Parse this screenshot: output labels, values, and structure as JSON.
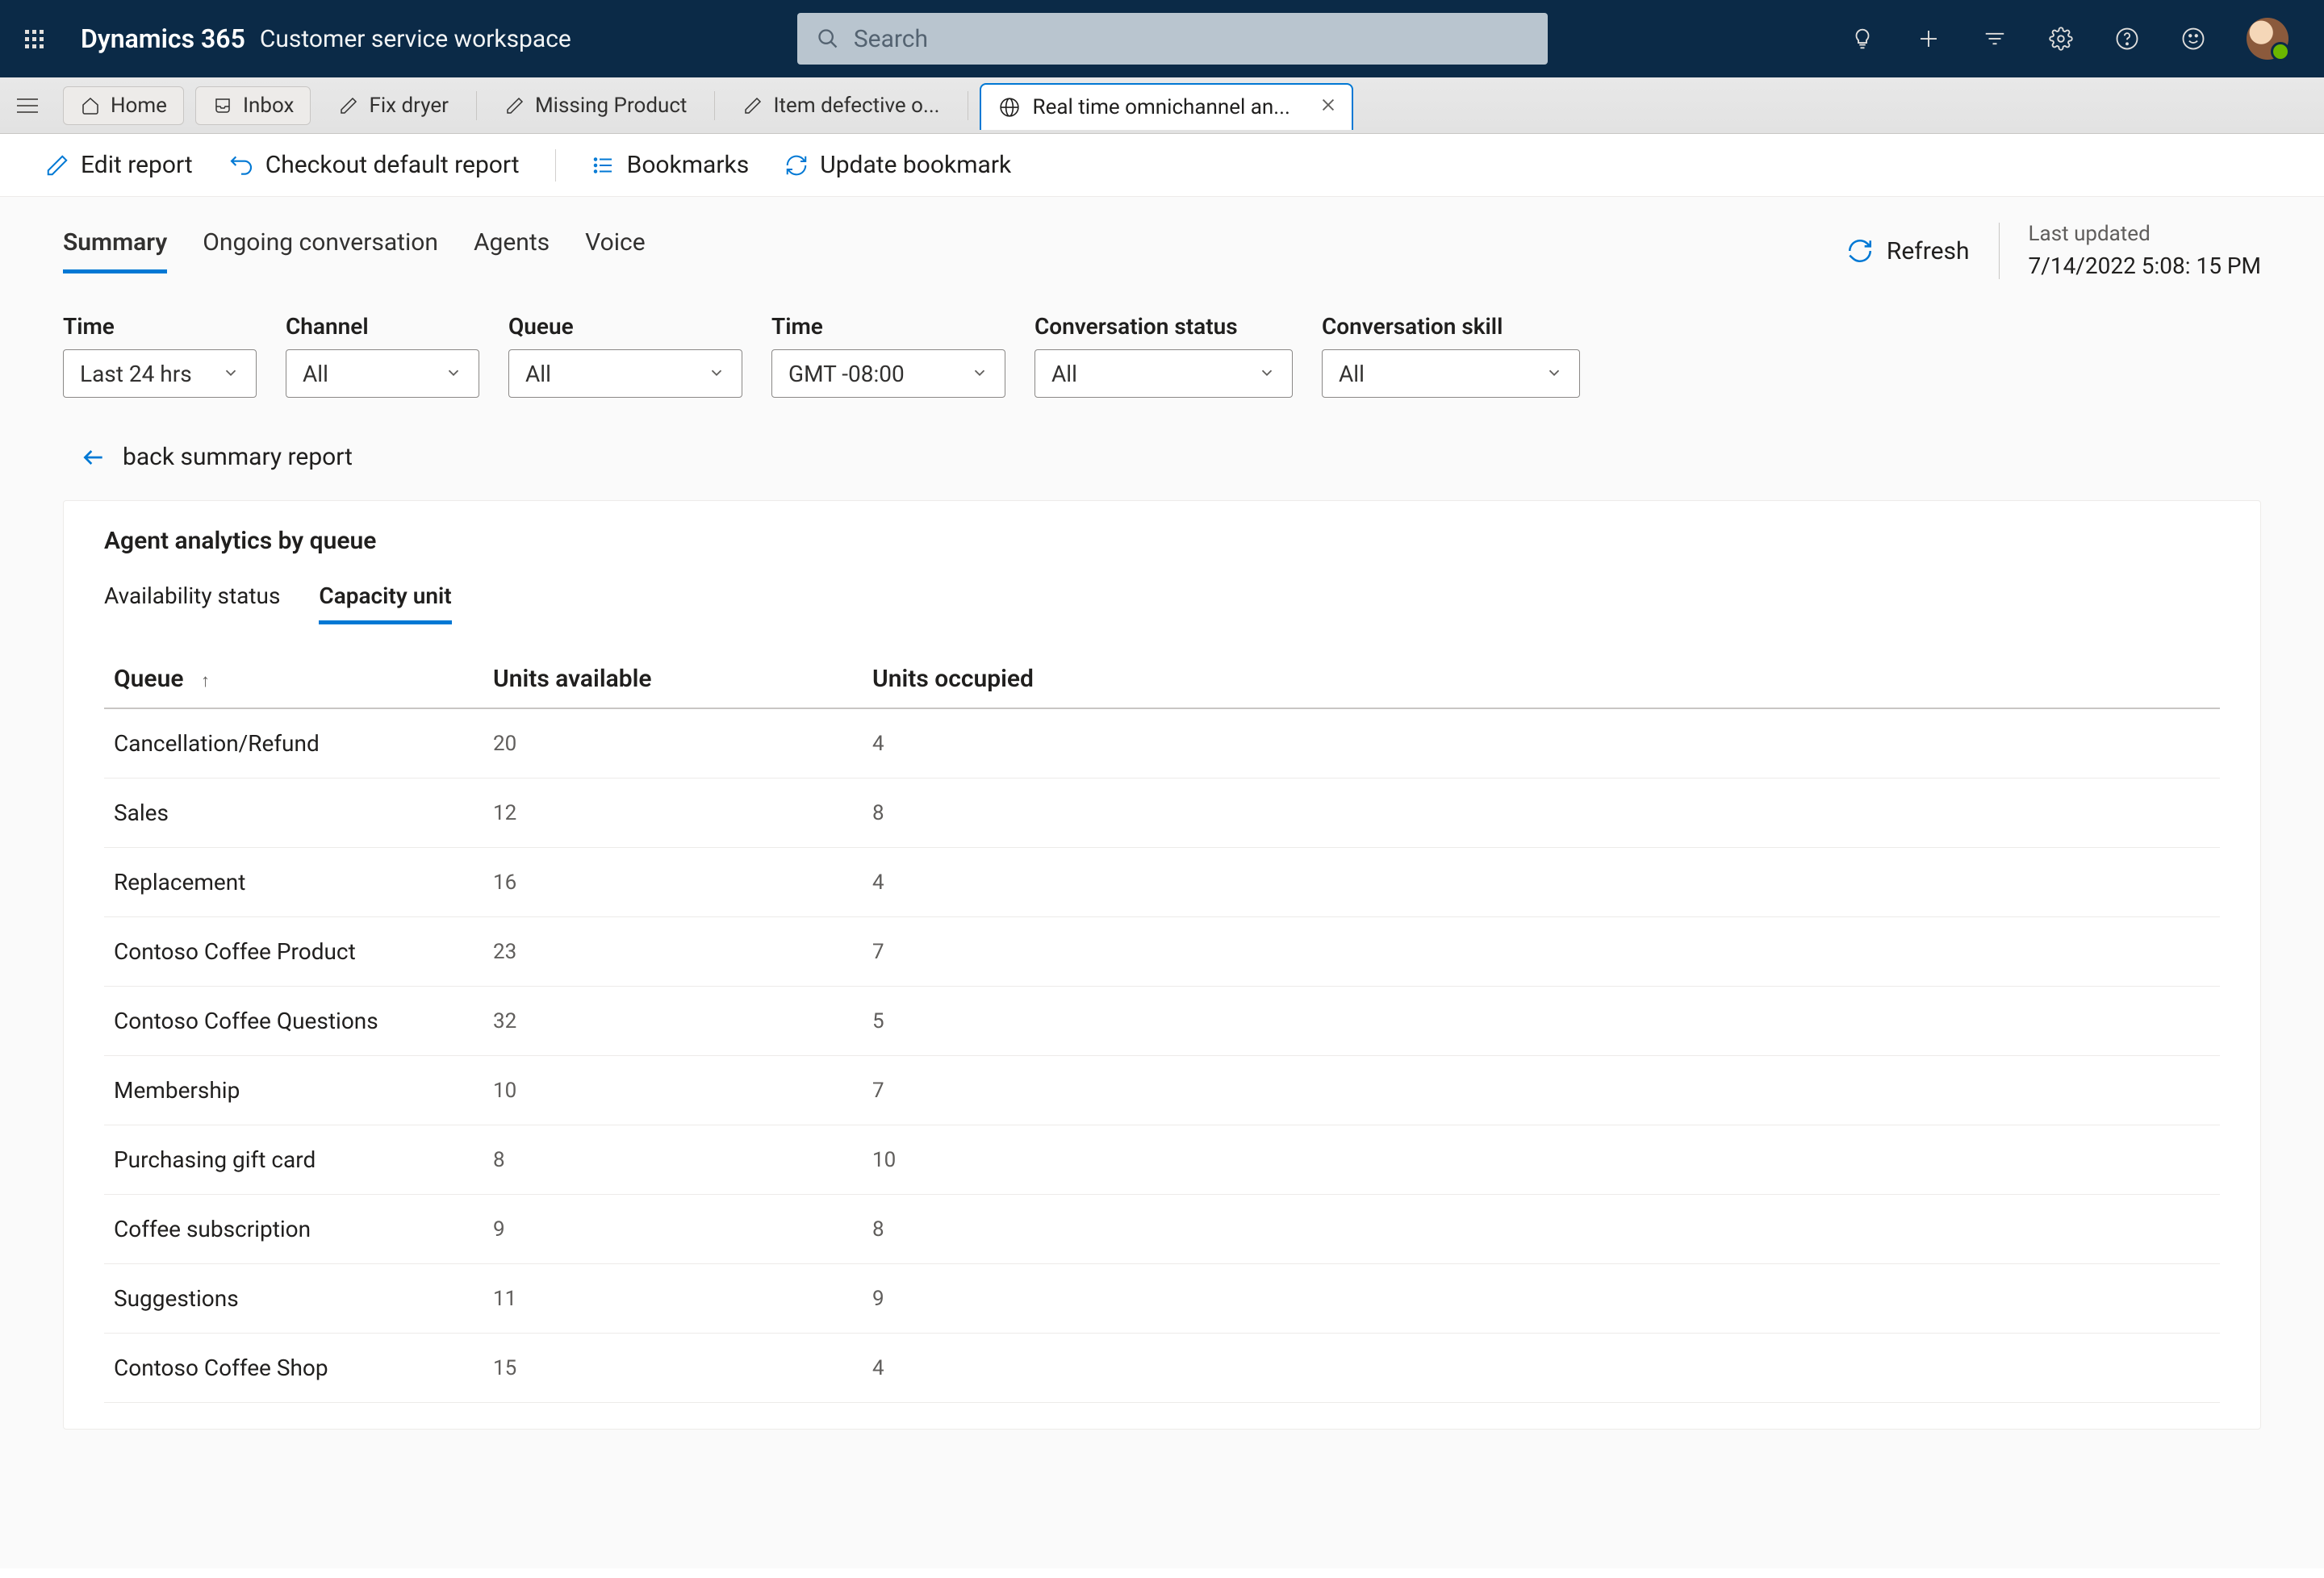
{
  "header": {
    "brand": "Dynamics 365",
    "workspace": "Customer service workspace",
    "search_placeholder": "Search"
  },
  "tabs": {
    "home": "Home",
    "inbox": "Inbox",
    "doc1": "Fix dryer",
    "doc2": "Missing Product",
    "doc3": "Item defective o...",
    "active": "Real time omnichannel an..."
  },
  "actions": {
    "edit": "Edit report",
    "checkout": "Checkout default report",
    "bookmarks": "Bookmarks",
    "update": "Update bookmark"
  },
  "view_tabs": {
    "summary": "Summary",
    "ongoing": "Ongoing conversation",
    "agents": "Agents",
    "voice": "Voice"
  },
  "refresh": {
    "label": "Refresh",
    "last_updated_label": "Last updated",
    "last_updated_value": "7/14/2022 5:08: 15 PM"
  },
  "filters": {
    "time_label": "Time",
    "time_value": "Last 24 hrs",
    "channel_label": "Channel",
    "channel_value": "All",
    "queue_label": "Queue",
    "queue_value": "All",
    "time2_label": "Time",
    "time2_value": "GMT -08:00",
    "status_label": "Conversation status",
    "status_value": "All",
    "skill_label": "Conversation skill",
    "skill_value": "All"
  },
  "back_link": "back summary report",
  "panel": {
    "title": "Agent analytics by queue",
    "tab_availability": "Availability status",
    "tab_capacity": "Capacity unit",
    "col_queue": "Queue",
    "col_available": "Units available",
    "col_occupied": "Units occupied"
  },
  "rows": [
    {
      "queue": "Cancellation/Refund",
      "available": "20",
      "occupied": "4"
    },
    {
      "queue": "Sales",
      "available": "12",
      "occupied": "8"
    },
    {
      "queue": "Replacement",
      "available": "16",
      "occupied": "4"
    },
    {
      "queue": "Contoso Coffee Product",
      "available": "23",
      "occupied": "7"
    },
    {
      "queue": "Contoso Coffee Questions",
      "available": "32",
      "occupied": "5"
    },
    {
      "queue": "Membership",
      "available": "10",
      "occupied": "7"
    },
    {
      "queue": "Purchasing gift card",
      "available": "8",
      "occupied": "10"
    },
    {
      "queue": "Coffee subscription",
      "available": "9",
      "occupied": "8"
    },
    {
      "queue": "Suggestions",
      "available": "11",
      "occupied": "9"
    },
    {
      "queue": "Contoso Coffee Shop",
      "available": "15",
      "occupied": "4"
    }
  ]
}
